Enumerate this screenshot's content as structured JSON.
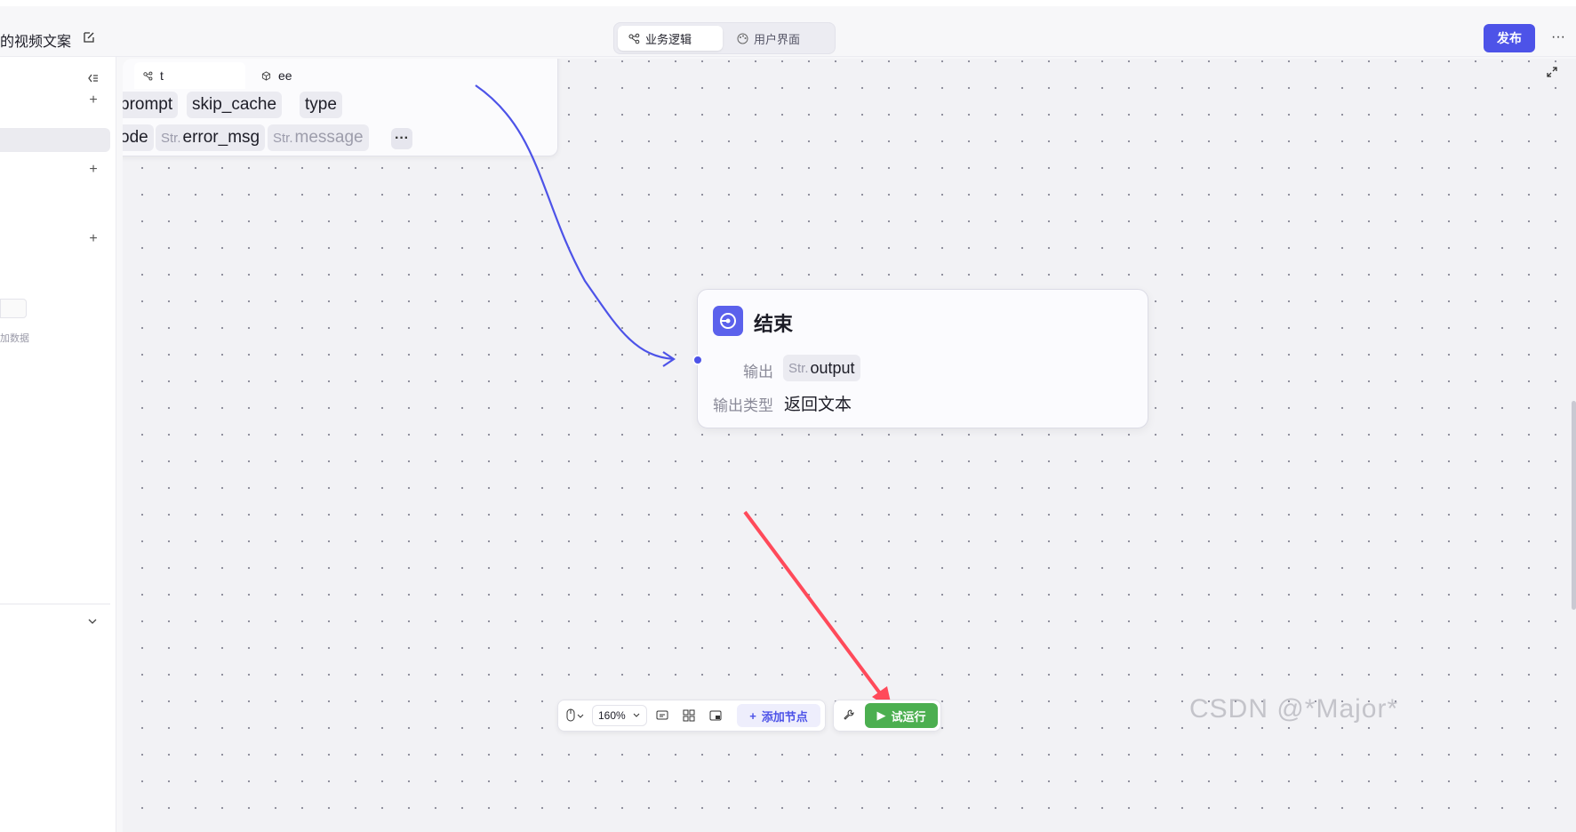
{
  "header": {
    "app_title": "的视频文案",
    "mode_tabs": [
      {
        "label": "业务逻辑",
        "active": true,
        "icon": "workflow-icon"
      },
      {
        "label": "用户界面",
        "active": false,
        "icon": "palette-icon"
      }
    ],
    "publish_label": "发布",
    "more_label": "···"
  },
  "sidebar": {
    "empty_text": "加数据"
  },
  "canvas": {
    "tabs": [
      {
        "label": "t",
        "icon": "workflow-icon",
        "active": true
      },
      {
        "label": "ee",
        "icon": "cube-icon",
        "active": false
      }
    ],
    "upstream_node": {
      "row1": [
        "prompt",
        "skip_cache",
        "type"
      ],
      "row2": [
        {
          "prefix": "",
          "name": "ode"
        },
        {
          "prefix": "Str.",
          "name": "error_msg"
        },
        {
          "prefix": "Str.",
          "name": "message"
        }
      ],
      "more_label": "···"
    },
    "end_node": {
      "title": "结束",
      "output_label": "输出",
      "output_prefix": "Str.",
      "output_value": "output",
      "output_type_label": "输出类型",
      "output_type_value": "返回文本"
    },
    "toolbar": {
      "zoom": "160%",
      "add_node_label": "添加节点",
      "run_label": "试运行"
    },
    "watermark": "CSDN @*Major*",
    "colors": {
      "accent": "#4d53e8",
      "run": "#4caf50",
      "arrow": "#ff4a5a"
    }
  }
}
